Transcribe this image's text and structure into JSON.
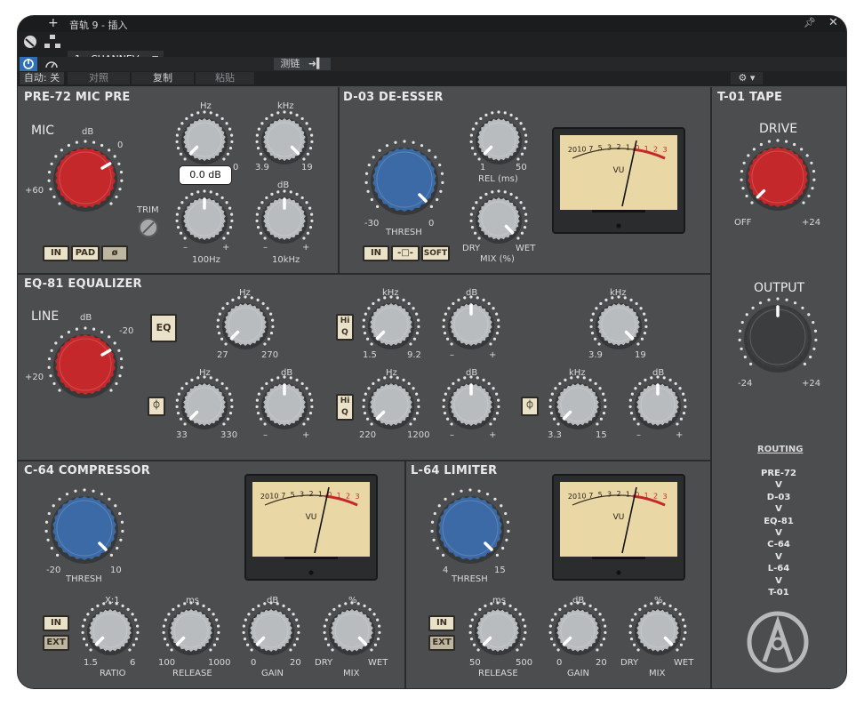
{
  "window": {
    "title": "音轨 9 - 插入",
    "channel": "1 - CHANNEV"
  },
  "toolbar": {
    "preset": "默认",
    "sidechain": "测链",
    "auto": "自动: 关",
    "compare": "对照",
    "copy": "复制",
    "paste": "粘贴"
  },
  "pre72": {
    "title": "PRE-72 MIC PRE",
    "mic": "MIC",
    "db": "dB",
    "zero": "0",
    "plus60": "+60",
    "trim": "TRIM",
    "hz": "Hz",
    "khz": "kHz",
    "low_min": "0",
    "hi_min": "3.9",
    "hi_max": "19",
    "tooltip": "0.0 dB",
    "db2": "dB",
    "minus": "–",
    "plus": "+",
    "minus2": "–",
    "plus2": "+",
    "hz100": "100Hz",
    "khz10": "10kHz",
    "btn_in": "IN",
    "btn_pad": "PAD",
    "btn_phase": "ø"
  },
  "d03": {
    "title": "D-03 DE-ESSER",
    "thresh": "THRESH",
    "t_min": "-30",
    "t_max": "0",
    "rel": "REL (ms)",
    "rel_min": "1",
    "rel_max": "50",
    "mix": "MIX (%)",
    "dry": "DRY",
    "wet": "WET",
    "btn_in": "IN",
    "btn_soft": "SOFT"
  },
  "eq81": {
    "title": "EQ-81 EQUALIZER",
    "line": "LINE",
    "db": "dB",
    "m20": "-20",
    "p20": "+20",
    "btn_eq": "EQ",
    "hiq": "Hi Q",
    "hz": "Hz",
    "khz": "kHz",
    "dbl": "dB",
    "lc_min": "27",
    "lc_max": "270",
    "lm_min": "1.5",
    "lm_max": "9.2",
    "hc_min": "3.9",
    "hc_max": "19",
    "ls_min": "33",
    "ls_max": "330",
    "mm_min": "220",
    "mm_max": "1200",
    "hs_min": "3.3",
    "hs_max": "15",
    "minus": "–",
    "plus": "+"
  },
  "c64": {
    "title": "C-64 COMPRESSOR",
    "thresh": "THRESH",
    "t_min": "-20",
    "t_max": "10",
    "btn_in": "IN",
    "btn_ext": "EXT",
    "ratio_u": "X:1",
    "ratio": "RATIO",
    "r_min": "1.5",
    "r_max": "6",
    "rel_u": "ms",
    "release": "RELEASE",
    "rel_min": "100",
    "rel_max": "1000",
    "gain_u": "dB",
    "gain": "GAIN",
    "g_min": "0",
    "g_max": "20",
    "mix_u": "%",
    "mix": "MIX",
    "dry": "DRY",
    "wet": "WET"
  },
  "l64": {
    "title": "L-64 LIMITER",
    "thresh": "THRESH",
    "t_min": "4",
    "t_max": "15",
    "btn_in": "IN",
    "btn_ext": "EXT",
    "rel_u": "ms",
    "release": "RELEASE",
    "rel_min": "50",
    "rel_max": "500",
    "gain_u": "dB",
    "gain": "GAIN",
    "g_min": "0",
    "g_max": "20",
    "mix_u": "%",
    "mix": "MIX",
    "dry": "DRY",
    "wet": "WET"
  },
  "t01": {
    "title": "T-01 TAPE",
    "drive": "DRIVE",
    "d_min": "OFF",
    "d_max": "+24",
    "output": "OUTPUT",
    "o_min": "-24",
    "o_max": "+24",
    "routing": "ROUTING",
    "chain": [
      "PRE-72",
      "V",
      "D-03",
      "V",
      "EQ-81",
      "V",
      "C-64",
      "V",
      "L-64",
      "V",
      "T-01"
    ]
  },
  "vu": {
    "scale": [
      "20",
      "10",
      "7",
      "5",
      "3",
      "2",
      "1",
      "0",
      "1",
      "2",
      "3"
    ],
    "label": "VU"
  },
  "colors": {
    "red": "#c5282b",
    "blue": "#3b6aa6",
    "grey": "#b9bcbf",
    "dark": "#3c3d3f",
    "panel": "#4d4f51"
  }
}
